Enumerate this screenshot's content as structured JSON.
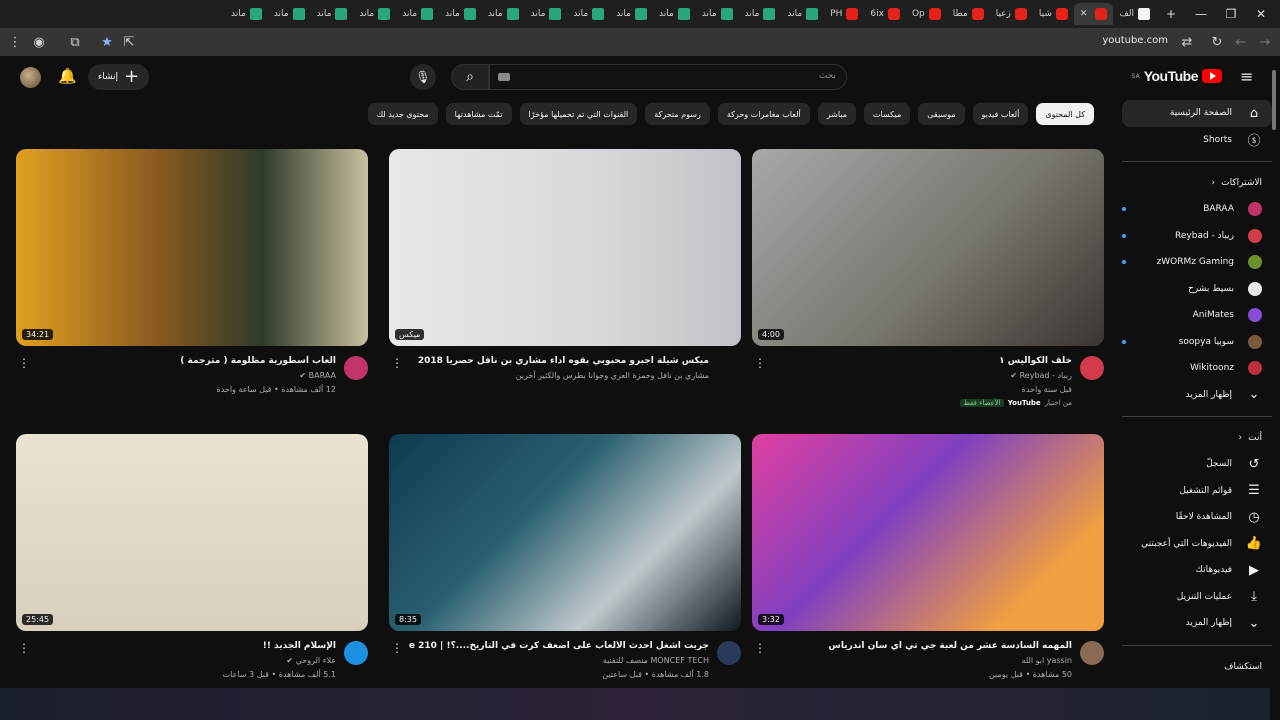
{
  "browser": {
    "tabs": [
      {
        "label": "الف",
        "icon": "favicon-g"
      },
      {
        "label": "",
        "icon": "favicon-youtube",
        "active": true
      },
      {
        "label": "شيا",
        "icon": "favicon-youtube"
      },
      {
        "label": "زعيا",
        "icon": "favicon-youtube"
      },
      {
        "label": "مطا",
        "icon": "favicon-youtube"
      },
      {
        "label": "Op",
        "icon": "favicon-youtube"
      },
      {
        "label": "6ix",
        "icon": "favicon-youtube"
      },
      {
        "label": "PH",
        "icon": "favicon-youtube"
      },
      {
        "label": "ماند",
        "icon": "favicon-m"
      },
      {
        "label": "ماند",
        "icon": "favicon-m"
      },
      {
        "label": "ماند",
        "icon": "favicon-m"
      },
      {
        "label": "ماند",
        "icon": "favicon-m"
      },
      {
        "label": "ماند",
        "icon": "favicon-m"
      },
      {
        "label": "ماند",
        "icon": "favicon-m"
      },
      {
        "label": "ماند",
        "icon": "favicon-m"
      },
      {
        "label": "ماند",
        "icon": "favicon-m"
      },
      {
        "label": "ماند",
        "icon": "favicon-m"
      },
      {
        "label": "ماند",
        "icon": "favicon-m"
      },
      {
        "label": "ماند",
        "icon": "favicon-m"
      },
      {
        "label": "ماند",
        "icon": "favicon-m"
      },
      {
        "label": "ماند",
        "icon": "favicon-m"
      },
      {
        "label": "ماند",
        "icon": "favicon-m"
      }
    ],
    "url": "youtube.com"
  },
  "header": {
    "logo_text": "YouTube",
    "logo_region": "SA",
    "search_placeholder": "بحث",
    "create_label": "إنشاء"
  },
  "chips": [
    "كل المحتوى",
    "ألعاب فيديو",
    "موسيقى",
    "ميكسات",
    "مباشر",
    "ألعاب مغامرات وحركة",
    "رسوم متحركة",
    "القنوات التي تم تحميلها مؤخرًا",
    "تمّت مشاهدتها",
    "محتوى جديد لك"
  ],
  "sidebar": {
    "home": "الصفحة الرئيسية",
    "shorts": "Shorts",
    "subscriptions_title": "الاشتراكات",
    "subscriptions": [
      {
        "name": "BARAA",
        "color": "#c0346a",
        "dot": true
      },
      {
        "name": "ريباد - Reybad",
        "color": "#d33b4a",
        "dot": true
      },
      {
        "name": "zWORMz Gaming",
        "color": "#6b8f2a",
        "dot": true
      },
      {
        "name": "بسيط بشرح",
        "color": "#e6e6e6",
        "dot": false
      },
      {
        "name": "AniMates",
        "color": "#8a4bd6",
        "dot": false
      },
      {
        "name": "سوبيا soopya",
        "color": "#7a5a3a",
        "dot": true
      },
      {
        "name": "Wikitoonz",
        "color": "#c0303a",
        "dot": false
      }
    ],
    "show_more_1": "إظهار المزيد",
    "you_title": "أنت",
    "you_items": [
      {
        "label": "السجلّ",
        "icon": "history-icon"
      },
      {
        "label": "قوائم التشغيل",
        "icon": "playlist-icon"
      },
      {
        "label": "المشاهدة لاحقًا",
        "icon": "clock-icon"
      },
      {
        "label": "الفيديوهات التي أعجبتني",
        "icon": "thumbs-up-icon"
      },
      {
        "label": "فيديوهاتك",
        "icon": "video-icon"
      },
      {
        "label": "عمليات التنزيل",
        "icon": "download-icon"
      }
    ],
    "show_more_2": "إظهار المزيد",
    "explore_title": "استكشاف"
  },
  "videos": [
    {
      "title": "خلف الكواليس ١",
      "channel": "ريباد - Reybad",
      "verified": true,
      "views": "قبل سنة واحدة",
      "duration": "4:00",
      "avatar_color": "#d33b4a",
      "badge": {
        "from": "من اختيار",
        "brand": "YouTube",
        "tag": "الأعضاء فقط"
      }
    },
    {
      "title": "ميكس شيلة اجبرو محبوبي بقوه   اداء مشاري بن نافل   حصرياً 2018",
      "channel": "مشاري بن نافل وحمزة العزي وجوانا بطرس والكثير آخرين",
      "verified": false,
      "views": "",
      "duration": "ميكس",
      "avatar_color": ""
    },
    {
      "title": "ألعاب اسطورية مظلومة ( مترجمة )",
      "channel": "BARAA",
      "verified": true,
      "views": "12 ألف مشاهدة • قبل ساعة واحدة",
      "duration": "34:21",
      "avatar_color": "#c0346a"
    },
    {
      "title": "المهمه السادسة عشر من لعبة جي تي اي سان اندرياس",
      "channel": "yassin ابو الله",
      "verified": false,
      "views": "50 مشاهدة • قبل يومين",
      "duration": "3:32",
      "avatar_color": "#8a6a52"
    },
    {
      "title": "جربت أشغل أحدث الألعاب على أضعف كرت في التاريخ....؟! | Geforce 210",
      "channel": "MONCEF TECH منصف للتقنية",
      "verified": false,
      "views": "1.8 ألف مشاهدة • قبل ساعتين",
      "duration": "8:35",
      "avatar_color": "#2a3a5a"
    },
    {
      "title": "الإسلام الجديد !!",
      "channel": "علاء الروحي",
      "verified": true,
      "views": "5.1 ألف مشاهدة • قبل 3 ساعات",
      "duration": "25:45",
      "avatar_color": "#1e90e0"
    }
  ]
}
